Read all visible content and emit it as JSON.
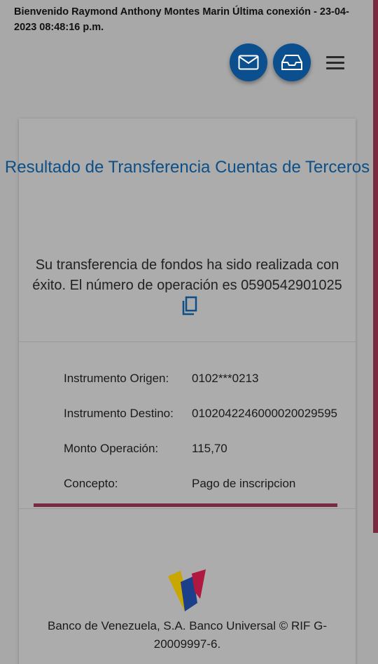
{
  "header": {
    "welcome_text": "Bienvenido Raymond Anthony Montes Marin Última conexión - 23-04-2023 08:48:16 p.m."
  },
  "icons": {
    "mail": "envelope-icon",
    "inbox": "inbox-tray-icon",
    "menu": "hamburger-menu-icon",
    "copy": "copy-icon"
  },
  "colors": {
    "brand_blue": "#0b4f8e",
    "title_blue": "#0d4f86",
    "accent_maroon": "#7a2a40"
  },
  "result": {
    "title": "Resultado de Transferencia Cuentas de Terceros",
    "message": "Su transferencia de fondos ha sido realizada con éxito. El número de operación es",
    "operation_number": "0590542901025"
  },
  "details": [
    {
      "label": "Instrumento Origen:",
      "value": "0102***0213"
    },
    {
      "label": "Instrumento Destino:",
      "value": "0102042246000020029595"
    },
    {
      "label": "Monto Operación:",
      "value": "115,70"
    },
    {
      "label": "Concepto:",
      "value": "Pago de inscripcion"
    }
  ],
  "footer": {
    "text": "Banco de Venezuela, S.A. Banco Universal © RIF G-20009997-6."
  }
}
